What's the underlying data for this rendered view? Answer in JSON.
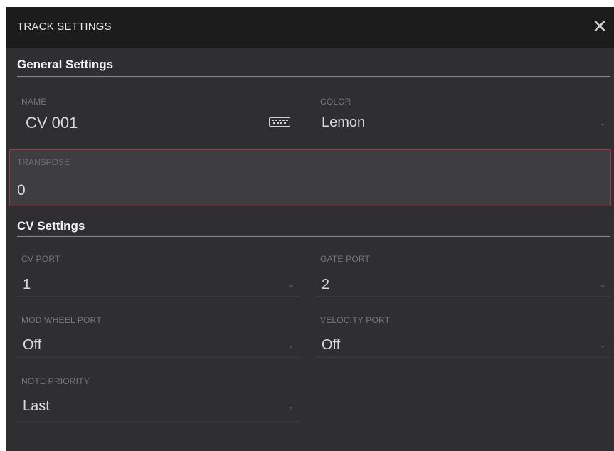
{
  "dialog": {
    "title": "TRACK SETTINGS",
    "close_icon": "close-icon"
  },
  "general": {
    "heading": "General Settings",
    "name": {
      "label": "NAME",
      "value": "CV 001",
      "keyboard_icon": "keyboard-icon"
    },
    "color": {
      "label": "COLOR",
      "value": "Lemon"
    },
    "transpose": {
      "label": "TRANSPOSE",
      "value": "0"
    }
  },
  "cv": {
    "heading": "CV Settings",
    "cv_port": {
      "label": "CV PORT",
      "value": "1"
    },
    "gate_port": {
      "label": "GATE PORT",
      "value": "2"
    },
    "mod_wheel_port": {
      "label": "MOD WHEEL PORT",
      "value": "Off"
    },
    "velocity_port": {
      "label": "VELOCITY PORT",
      "value": "Off"
    },
    "note_priority": {
      "label": "NOTE PRIORITY",
      "value": "Last"
    }
  },
  "colors": {
    "background": "#2f2f31",
    "titlebar": "#1c1c1d",
    "focus_border": "#a3344e"
  }
}
